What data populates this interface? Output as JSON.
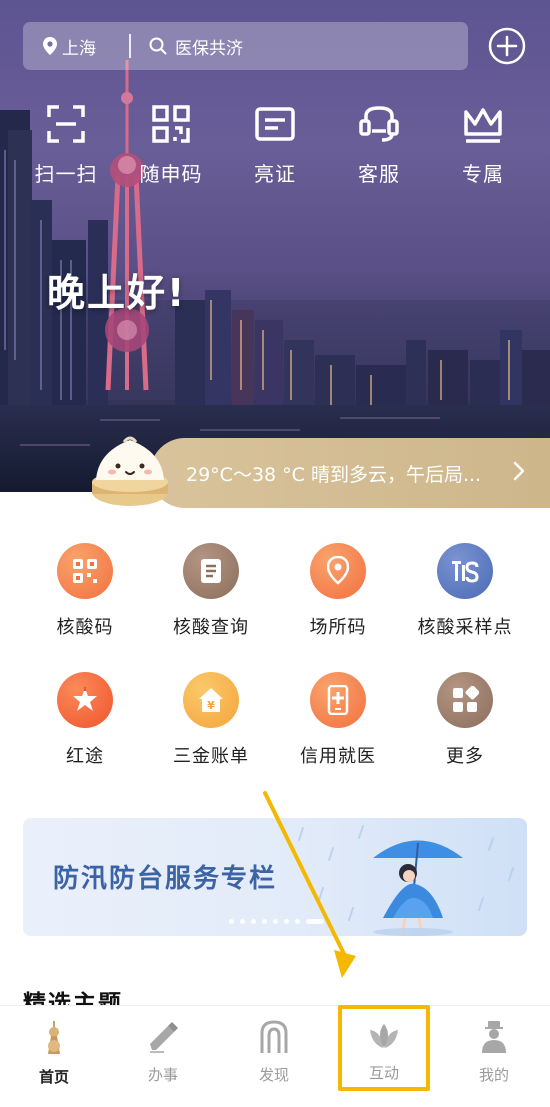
{
  "header": {
    "location": "上海",
    "search_placeholder": "医保共济"
  },
  "quick_actions": [
    {
      "label": "扫一扫",
      "icon": "scan-icon"
    },
    {
      "label": "随申码",
      "icon": "qr-code-icon"
    },
    {
      "label": "亮证",
      "icon": "id-card-icon"
    },
    {
      "label": "客服",
      "icon": "customer-service-icon"
    },
    {
      "label": "专属",
      "icon": "crown-icon"
    }
  ],
  "greeting": "晚上好!",
  "weather": {
    "text": "29°C～38 °C 晴到多云，午后局..."
  },
  "services": [
    {
      "label": "核酸码",
      "icon": "qr-grid-icon",
      "color": "#f2703f"
    },
    {
      "label": "核酸查询",
      "icon": "document-icon",
      "color": "#8c6e5d"
    },
    {
      "label": "场所码",
      "icon": "location-pin-icon",
      "color": "#f2703f"
    },
    {
      "label": "核酸采样点",
      "icon": "sampling-point-icon",
      "color": "#4b6bb5"
    },
    {
      "label": "红途",
      "icon": "star-flag-icon",
      "color": "#f0542d"
    },
    {
      "label": "三金账单",
      "icon": "yuan-house-icon",
      "color": "#f3a53c"
    },
    {
      "label": "信用就医",
      "icon": "medical-phone-icon",
      "color": "#f2703f"
    },
    {
      "label": "更多",
      "icon": "more-grid-icon",
      "color": "#8c6e5d"
    }
  ],
  "banner": {
    "title": "防汛防台服务专栏"
  },
  "section": {
    "title": "精选主题"
  },
  "tabs": [
    {
      "label": "首页",
      "icon": "home-tower-icon",
      "active": true
    },
    {
      "label": "办事",
      "icon": "pen-icon",
      "active": false
    },
    {
      "label": "发现",
      "icon": "arch-icon",
      "active": false
    },
    {
      "label": "互动",
      "icon": "lotus-icon",
      "active": false
    },
    {
      "label": "我的",
      "icon": "person-icon",
      "active": false
    }
  ],
  "colors": {
    "accent": "#f2703f",
    "highlight": "#f4b800",
    "weather_bar": "#d4bd93"
  }
}
